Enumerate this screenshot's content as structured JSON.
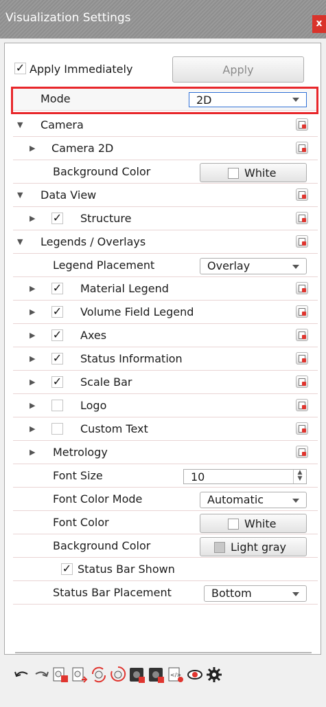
{
  "window": {
    "title": "Visualization Settings",
    "close_label": "x"
  },
  "apply_immediately": {
    "label": "Apply Immediately",
    "checked": true
  },
  "apply_button": {
    "label": "Apply"
  },
  "mode": {
    "label": "Mode",
    "value": "2D"
  },
  "camera": {
    "label": "Camera",
    "camera2d_label": "Camera 2D",
    "background_color": {
      "label": "Background Color",
      "value": "White",
      "swatch": "#ffffff"
    }
  },
  "data_view": {
    "label": "Data View",
    "structure": {
      "label": "Structure",
      "checked": true
    }
  },
  "legends": {
    "label": "Legends / Overlays",
    "placement": {
      "label": "Legend Placement",
      "value": "Overlay"
    },
    "items": [
      {
        "label": "Material Legend",
        "checked": true
      },
      {
        "label": "Volume Field Legend",
        "checked": true
      },
      {
        "label": "Axes",
        "checked": true
      },
      {
        "label": "Status Information",
        "checked": true
      },
      {
        "label": "Scale Bar",
        "checked": true
      },
      {
        "label": "Logo",
        "checked": false
      },
      {
        "label": "Custom Text",
        "checked": false
      }
    ],
    "metrology_label": "Metrology",
    "font_size": {
      "label": "Font Size",
      "value": "10"
    },
    "font_color_mode": {
      "label": "Font Color Mode",
      "value": "Automatic"
    },
    "font_color": {
      "label": "Font Color",
      "value": "White",
      "swatch": "#ffffff"
    },
    "background_color": {
      "label": "Background Color",
      "value": "Light gray",
      "swatch": "#c8c8c8"
    },
    "status_bar_shown": {
      "label": "Status Bar Shown",
      "checked": true
    },
    "status_bar_placement": {
      "label": "Status Bar Placement",
      "value": "Bottom"
    }
  },
  "toolbar": {
    "icons": [
      "undo-icon",
      "redo-icon",
      "load-settings-icon",
      "save-settings-icon",
      "sync-icon",
      "reset-icon",
      "reset-all-icon",
      "export-icon",
      "visibility-icon",
      "settings-icon"
    ]
  },
  "colors": {
    "accent_red": "#e8262a",
    "checked_mark": "✓"
  }
}
